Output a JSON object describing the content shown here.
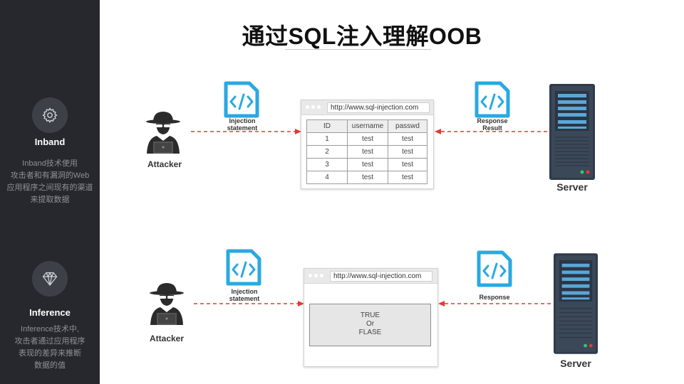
{
  "title": "通过SQL注入理解OOB",
  "sidebar": {
    "sections": [
      {
        "icon": "gear-icon",
        "title": "Inband",
        "description": [
          "Inband技术使用",
          "攻击者和有漏洞的Web",
          "应用程序之间现有的渠道",
          "来提取数据"
        ]
      },
      {
        "icon": "diamond-icon",
        "title": "Inference",
        "description": [
          "Inference技术中,",
          "攻击者通过应用程序",
          "表现的差异来推断",
          "数据的值"
        ]
      }
    ]
  },
  "colors": {
    "sidebar_bg": "#26282d",
    "arrow": "#e53935",
    "doc_icon": "#29a9e1",
    "server_body": "#2f3b4a"
  },
  "diagrams": [
    {
      "actor_label": "Attacker",
      "request_label": [
        "Injection",
        "statement"
      ],
      "url": "http://www.sql-injection.com",
      "table": {
        "headers": [
          "ID",
          "username",
          "passwd"
        ],
        "rows": [
          [
            "1",
            "test",
            "test"
          ],
          [
            "2",
            "test",
            "test"
          ],
          [
            "3",
            "test",
            "test"
          ],
          [
            "4",
            "test",
            "test"
          ]
        ]
      },
      "response_label": [
        "Response",
        "Result"
      ],
      "server_label": "Server"
    },
    {
      "actor_label": "Attacker",
      "request_label": [
        "Injection",
        "statement"
      ],
      "url": "http://www.sql-injection.com",
      "result_box": [
        "TRUE",
        "Or",
        "FLASE"
      ],
      "response_label": [
        "Response"
      ],
      "server_label": "Server"
    }
  ]
}
